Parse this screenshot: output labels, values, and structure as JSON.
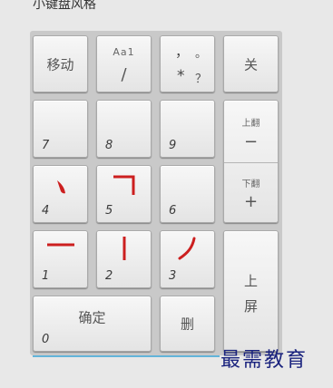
{
  "caption": "小键盘风格",
  "keys": {
    "move": "移动",
    "aa1_top": "Aa1",
    "aa1_bottom": "/",
    "punct_top_left": "，",
    "punct_top_right": "。",
    "punct_bottom_left": "*",
    "punct_bottom_right": "？",
    "close": "关",
    "k7": "7",
    "k8": "8",
    "k9": "9",
    "pageup_label": "上翻",
    "pageup_symbol": "−",
    "pagedown_label": "下翻",
    "pagedown_symbol": "+",
    "k4": "4",
    "k5": "5",
    "k6": "6",
    "k1": "1",
    "k2": "2",
    "k3": "3",
    "commit_line1": "上",
    "commit_line2": "屏",
    "confirm": "确定",
    "k0": "0",
    "delete": "删"
  },
  "watermark": "最需教育",
  "colors": {
    "stroke": "#cc1f1f",
    "watermark": "#1a237e",
    "accent_line": "#63b4d9"
  }
}
